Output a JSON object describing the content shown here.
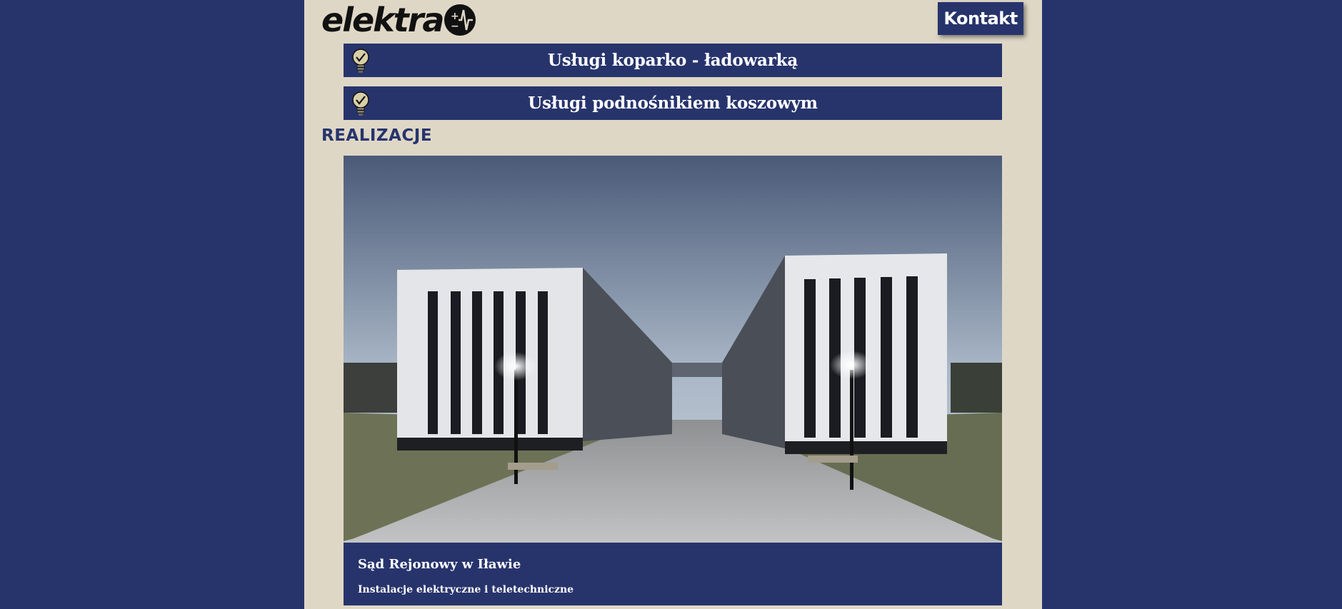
{
  "header": {
    "logo_text": "elektra",
    "contact_label": "Kontakt"
  },
  "services": [
    {
      "label": "Usługi koparko - ładowarką",
      "icon": "lightbulb-check-icon"
    },
    {
      "label": "Usługi podnośnikiem koszowym",
      "icon": "lightbulb-check-icon"
    }
  ],
  "realizations": {
    "heading": "REALIZACJE",
    "project": {
      "title": "Sąd Rejonowy w Iławie",
      "subtitle": "Instalacje elektryczne i teletechniczne"
    }
  },
  "colors": {
    "brand_navy": "#27346c",
    "page_beige": "#dfd7c6",
    "logo_black": "#111111"
  }
}
